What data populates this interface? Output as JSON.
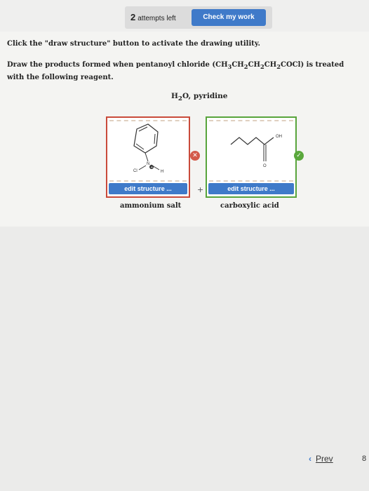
{
  "topbar": {
    "attempts_count": "2",
    "attempts_text": "attempts left",
    "check_label": "Check my work"
  },
  "instruction": "Click the \"draw structure\" button to activate the drawing utility.",
  "question": {
    "prefix": "Draw the products formed when pentanoyl chloride (",
    "formula_parts": [
      "CH",
      "3",
      "CH",
      "2",
      "CH",
      "2",
      "CH",
      "2",
      "COCl"
    ],
    "suffix": ") is treated with the following reagent."
  },
  "reagent": {
    "h": "H",
    "sub": "2",
    "rest": "O, pyridine"
  },
  "products": [
    {
      "edit_label": "edit structure ...",
      "product_label": "ammonium salt",
      "status": "incorrect",
      "atom_labels": {
        "cl": "Cl",
        "n": "N",
        "h": "H",
        "charge": "+"
      }
    },
    {
      "edit_label": "edit structure ...",
      "product_label": "carboxylic acid",
      "status": "correct",
      "atom_labels": {
        "oh": "OH",
        "o": "O"
      }
    }
  ],
  "plus_sign": "+",
  "status_colors": {
    "incorrect": "#d35a4a",
    "correct": "#5aa83c",
    "accent": "#3f7ac9"
  },
  "icons": {
    "incorrect": "x-icon",
    "correct": "checkmark-icon"
  },
  "nav": {
    "prev_label": "Prev",
    "page_number": "8"
  }
}
